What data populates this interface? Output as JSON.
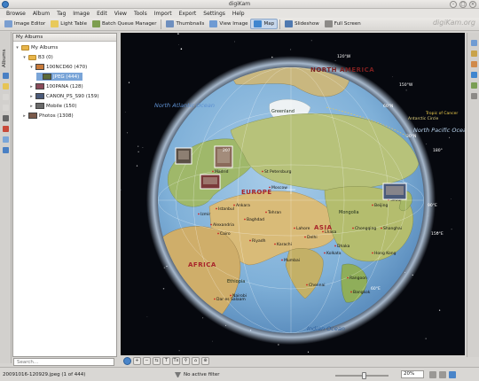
{
  "window": {
    "title": "digiKam"
  },
  "menubar": [
    "Browse",
    "Album",
    "Tag",
    "Image",
    "Edit",
    "View",
    "Tools",
    "Import",
    "Export",
    "Settings",
    "Help"
  ],
  "toolbar": {
    "buttons": [
      {
        "label": "Image Editor",
        "icon": "image-editor-icon",
        "color": "#7a9ed0"
      },
      {
        "label": "Light Table",
        "icon": "light-table-icon",
        "color": "#e8c95a"
      },
      {
        "label": "Batch Queue Manager",
        "icon": "batch-queue-icon",
        "color": "#7d9e4f"
      },
      {
        "label": "Thumbnails",
        "icon": "thumbnails-icon",
        "color": "#6e8fbf"
      },
      {
        "label": "View Image",
        "icon": "view-image-icon",
        "color": "#6f9bd3"
      },
      {
        "label": "Map",
        "icon": "map-icon",
        "color": "#3f86cf",
        "active": true
      },
      {
        "label": "Slideshow",
        "icon": "slideshow-icon",
        "color": "#4f79b0"
      },
      {
        "label": "Full Screen",
        "icon": "full-screen-icon",
        "color": "#8c8a87"
      }
    ],
    "brand": "digiKam.org"
  },
  "sidebar_left": {
    "active_tab": "Albums",
    "tab_colors": [
      "#4a80c4",
      "#e6c454",
      "#d9d7d4",
      "#d9d7d4",
      "#666666",
      "#c84a3a",
      "#7aa5d8",
      "#4a80c4"
    ]
  },
  "albums": {
    "header": "My Albums",
    "rows": [
      {
        "label": "My Albums",
        "level": 0,
        "twisty": "▾",
        "icon": "folder-icon"
      },
      {
        "label": "B3 (0)",
        "level": 1,
        "twisty": "▾",
        "icon": "folder-icon"
      },
      {
        "label": "100NCD60 (470)",
        "level": 2,
        "twisty": "▾",
        "icon": "album-thumb-icon",
        "thumb_color": "#c87a3a"
      },
      {
        "label": "JPEG (444)",
        "level": 3,
        "twisty": "",
        "icon": "album-thumb-icon",
        "thumb_color": "#5a6a3a",
        "selected": true
      },
      {
        "label": "100PANA (128)",
        "level": 2,
        "twisty": "▸",
        "icon": "album-thumb-icon",
        "thumb_color": "#8a4a5a"
      },
      {
        "label": "CANON_PS_S90 (159)",
        "level": 2,
        "twisty": "▸",
        "icon": "album-thumb-icon",
        "thumb_color": "#4a5a7a"
      },
      {
        "label": "Mobile (150)",
        "level": 2,
        "twisty": "▸",
        "icon": "album-thumb-icon",
        "thumb_color": "#6a6a6a"
      },
      {
        "label": "Photos (1308)",
        "level": 1,
        "twisty": "▸",
        "icon": "album-thumb-icon",
        "thumb_color": "#7a5a4a"
      }
    ],
    "search_placeholder": "Search..."
  },
  "map": {
    "labels": [
      {
        "text": "NORTH AMERICA",
        "kind": "continent"
      },
      {
        "text": "North Atlantic Ocean",
        "kind": "ocean"
      },
      {
        "text": "North Pacific Ocean",
        "kind": "ocean"
      },
      {
        "text": "Indian Ocean",
        "kind": "ocean"
      },
      {
        "text": "ASIA",
        "kind": "continent"
      },
      {
        "text": "EUROPE",
        "kind": "continent"
      },
      {
        "text": "AFRICA",
        "kind": "continent"
      },
      {
        "text": "Greenland",
        "kind": "place"
      },
      {
        "text": "Antarctic Circle",
        "kind": "line"
      },
      {
        "text": "Tropic of Cancer",
        "kind": "line"
      },
      {
        "text": "St Petersburg",
        "kind": "city"
      },
      {
        "text": "Moscow",
        "kind": "city"
      },
      {
        "text": "Madrid",
        "kind": "city"
      },
      {
        "text": "Istanbul",
        "kind": "city"
      },
      {
        "text": "Alexandria",
        "kind": "city"
      },
      {
        "text": "Baghdad",
        "kind": "city"
      },
      {
        "text": "Tehran",
        "kind": "city"
      },
      {
        "text": "Karachi",
        "kind": "city"
      },
      {
        "text": "Mumbai",
        "kind": "city"
      },
      {
        "text": "Delhi",
        "kind": "city"
      },
      {
        "text": "Lahore",
        "kind": "city"
      },
      {
        "text": "Kolkata",
        "kind": "city"
      },
      {
        "text": "Chennai",
        "kind": "city"
      },
      {
        "text": "Rangoon",
        "kind": "city"
      },
      {
        "text": "Beijing",
        "kind": "city"
      },
      {
        "text": "Shanghai",
        "kind": "city"
      },
      {
        "text": "Chongqing",
        "kind": "city"
      },
      {
        "text": "Seoul",
        "kind": "city"
      },
      {
        "text": "Mongolia",
        "kind": "place"
      },
      {
        "text": "Ethiopia",
        "kind": "place"
      },
      {
        "text": "Riyadh",
        "kind": "city"
      },
      {
        "text": "Dar es Salaam",
        "kind": "city"
      },
      {
        "text": "Nairobi",
        "kind": "city"
      },
      {
        "text": "Cairo",
        "kind": "city"
      },
      {
        "text": "Izmir",
        "kind": "city"
      },
      {
        "text": "Ankara",
        "kind": "city"
      },
      {
        "text": "Bangkok",
        "kind": "city"
      },
      {
        "text": "Hong Kong",
        "kind": "city"
      },
      {
        "text": "Dhaka",
        "kind": "city"
      },
      {
        "text": "Lhasa",
        "kind": "city"
      }
    ],
    "graticule": [
      {
        "text": "120°W"
      },
      {
        "text": "150°W"
      },
      {
        "text": "180°"
      },
      {
        "text": "150°E"
      },
      {
        "text": "30°N"
      },
      {
        "text": "60°N"
      },
      {
        "text": "90°E"
      },
      {
        "text": "60°E"
      }
    ],
    "markers": [
      {
        "badge": ""
      },
      {
        "badge": "207"
      },
      {
        "badge": ""
      },
      {
        "badge": ""
      }
    ]
  },
  "map_controls": [
    "◉",
    "+",
    "−",
    "⇆",
    "T",
    "Tx",
    "⚲",
    "⌂",
    "⊕"
  ],
  "status": {
    "file": "20091016-120929.jpeg (1 of 444)",
    "filter": "No active filter",
    "zoom": "20%",
    "zoom_fraction": 0.55
  }
}
